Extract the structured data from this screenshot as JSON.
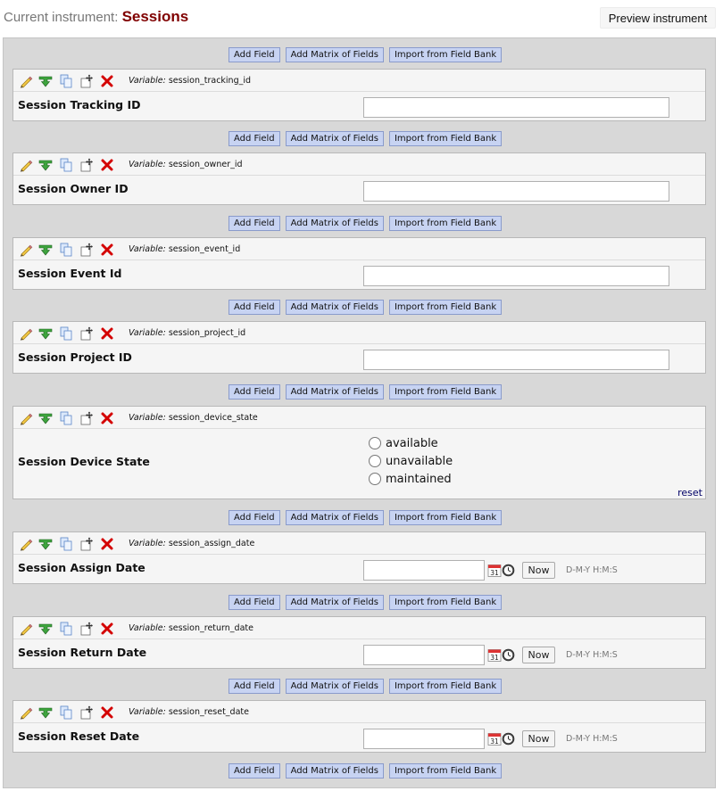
{
  "header": {
    "label": "Current instrument:",
    "instrument_name": "Sessions",
    "preview_button": "Preview instrument"
  },
  "add_buttons": {
    "add_field": "Add Field",
    "add_matrix": "Add Matrix of Fields",
    "import_bank": "Import from Field Bank"
  },
  "variable_prefix": "Variable:",
  "fields": [
    {
      "variable": "session_tracking_id",
      "label": "Session Tracking ID",
      "type": "text",
      "value": ""
    },
    {
      "variable": "session_owner_id",
      "label": "Session Owner ID",
      "type": "text",
      "value": ""
    },
    {
      "variable": "session_event_id",
      "label": "Session Event Id",
      "type": "text",
      "value": ""
    },
    {
      "variable": "session_project_id",
      "label": "Session Project ID",
      "type": "text",
      "value": ""
    },
    {
      "variable": "session_device_state",
      "label": "Session Device State",
      "type": "radio",
      "options": [
        "available",
        "unavailable",
        "maintained"
      ],
      "reset_label": "reset"
    },
    {
      "variable": "session_assign_date",
      "label": "Session Assign Date",
      "type": "datetime",
      "value": "",
      "now_label": "Now",
      "format": "D-M-Y H:M:S"
    },
    {
      "variable": "session_return_date",
      "label": "Session Return Date",
      "type": "datetime",
      "value": "",
      "now_label": "Now",
      "format": "D-M-Y H:M:S"
    },
    {
      "variable": "session_reset_date",
      "label": "Session Reset Date",
      "type": "datetime",
      "value": "",
      "now_label": "Now",
      "format": "D-M-Y H:M:S"
    }
  ],
  "icons": [
    "pencil-icon",
    "branching-icon",
    "copy-icon",
    "move-icon",
    "delete-icon",
    "calendar-icon",
    "clock-icon"
  ],
  "colors": {
    "instrument_title": "#800000",
    "add_button_bg": "#c7d3f2",
    "field_bg": "#f5f5f5",
    "frame_bg": "#d8d8d8"
  }
}
